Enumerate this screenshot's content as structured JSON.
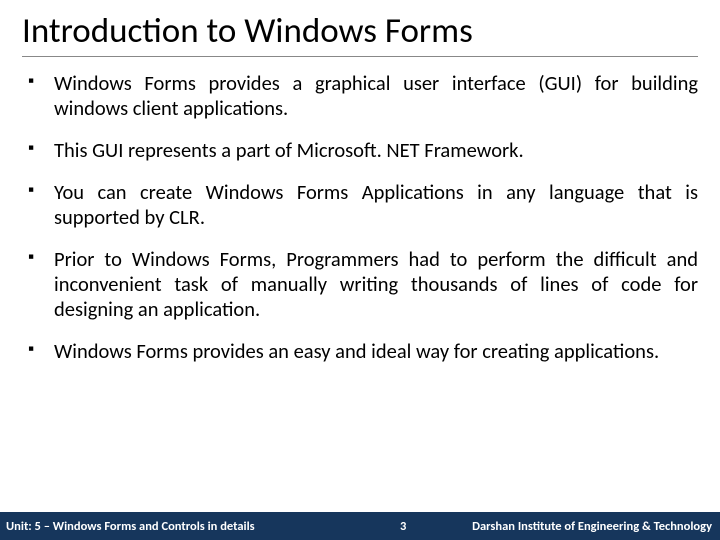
{
  "title": "Introduction to Windows Forms",
  "bullets": [
    "Windows Forms provides a graphical user interface (GUI) for building windows client applications.",
    "This GUI represents a part of Microsoft. NET Framework.",
    "You can create Windows Forms Applications in any language that is supported by CLR.",
    "Prior to Windows Forms, Programmers had to perform the difficult and inconvenient task of manually writing thousands of lines of code for designing an application.",
    "Windows Forms provides an easy and ideal way for creating applications."
  ],
  "footer": {
    "unit": "Unit: 5 – Windows Forms and Controls in details",
    "page": "3",
    "institute": "Darshan Institute of Engineering & Technology"
  }
}
